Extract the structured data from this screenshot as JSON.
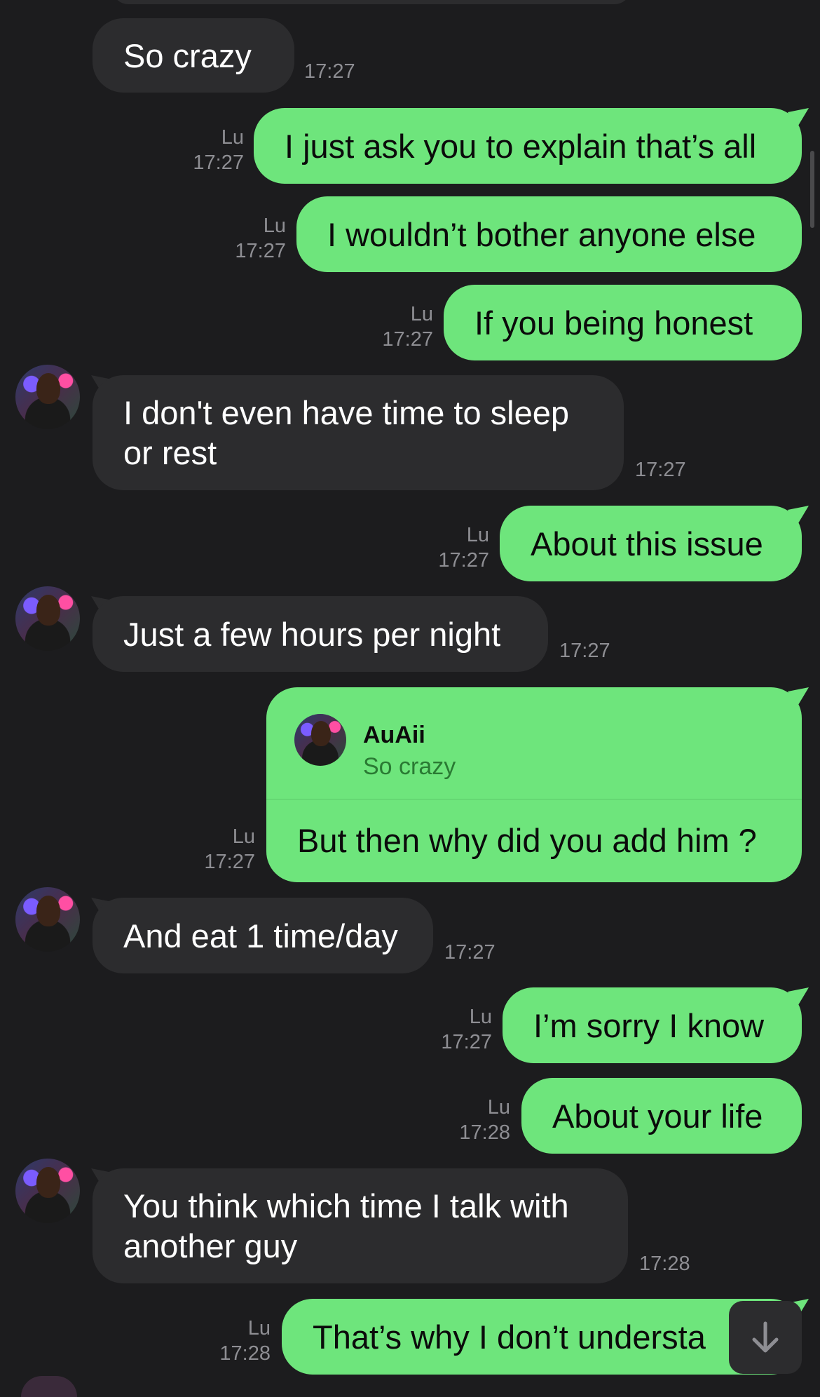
{
  "colors": {
    "background": "#1c1c1e",
    "incoming_bubble": "#2c2c2e",
    "outgoing_bubble": "#6ee57c",
    "meta_text": "#8e8e93"
  },
  "messages": [
    {
      "text": "So crazy",
      "time": "17:27"
    },
    {
      "sender": "Lu",
      "text": "I just ask you to explain that’s all",
      "time": "17:27"
    },
    {
      "sender": "Lu",
      "text": "I wouldn’t bother anyone else",
      "time": "17:27"
    },
    {
      "sender": "Lu",
      "text": "If you being honest",
      "time": "17:27"
    },
    {
      "text": "I don't even have time to sleep or rest",
      "time": "17:27"
    },
    {
      "sender": "Lu",
      "text": "About this issue",
      "time": "17:27"
    },
    {
      "text": "Just a few hours per night",
      "time": "17:27"
    },
    {
      "sender": "Lu",
      "reply_to_name": "AuAii",
      "reply_to_text": "So crazy",
      "text": "But then why did you add him ?",
      "time": "17:27"
    },
    {
      "text": "And eat 1 time/day",
      "time": "17:27"
    },
    {
      "sender": "Lu",
      "text": "I’m sorry I know",
      "time": "17:27"
    },
    {
      "sender": "Lu",
      "text": "About your life",
      "time": "17:28"
    },
    {
      "text": "You think which time I talk with another guy",
      "time": "17:28"
    },
    {
      "sender": "Lu",
      "text": "That’s why I don’t understa",
      "time": "17:28"
    }
  ],
  "icons": {
    "avatar": "avatar",
    "scroll_down": "arrow-down-icon"
  }
}
